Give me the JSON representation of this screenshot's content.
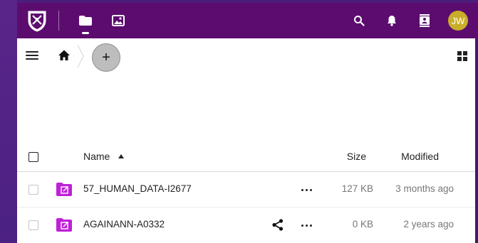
{
  "header": {
    "logo_icon": "university-crest-icon",
    "apps": [
      {
        "name": "files",
        "icon": "folder-icon",
        "active": true
      },
      {
        "name": "photos",
        "icon": "image-icon",
        "active": false
      }
    ],
    "avatar_initials": "JW",
    "colors": {
      "header_bg": "#5c0c6e",
      "avatar_bg": "#c9ae2a",
      "folder": "#c020d8"
    }
  },
  "toolbar": {
    "new_button_label": "+"
  },
  "table": {
    "headers": {
      "name": "Name",
      "size": "Size",
      "modified": "Modified"
    },
    "rows": [
      {
        "name": "57_HUMAN_DATA-I2677",
        "size": "127 KB",
        "modified": "3 months ago",
        "shared": false
      },
      {
        "name": "AGAINANN-A0332",
        "size": "0 KB",
        "modified": "2 years ago",
        "shared": true
      }
    ]
  }
}
